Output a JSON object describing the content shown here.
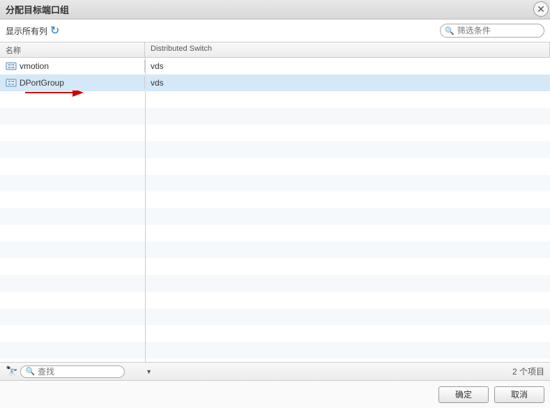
{
  "dialog": {
    "title": "分配目标端口组"
  },
  "toolbar": {
    "show_all_label": "显示所有列",
    "filter_placeholder": "筛选条件"
  },
  "table": {
    "columns": {
      "name": "名称",
      "switch": "Distributed Switch"
    },
    "rows": [
      {
        "name": "vmotion",
        "switch": "vds",
        "selected": false
      },
      {
        "name": "DPortGroup",
        "switch": "vds",
        "selected": true
      }
    ]
  },
  "statusbar": {
    "search_placeholder": "查找",
    "count_text": "2 个项目"
  },
  "footer": {
    "ok": "确定",
    "cancel": "取消"
  }
}
